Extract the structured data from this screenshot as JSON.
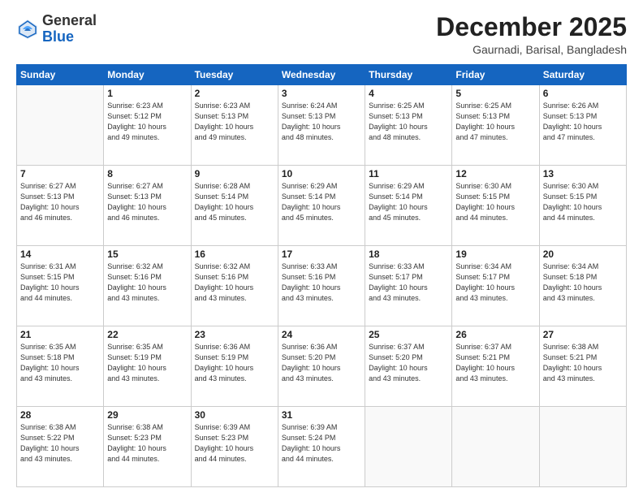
{
  "logo": {
    "general": "General",
    "blue": "Blue"
  },
  "header": {
    "month": "December 2025",
    "location": "Gaurnadi, Barisal, Bangladesh"
  },
  "weekdays": [
    "Sunday",
    "Monday",
    "Tuesday",
    "Wednesday",
    "Thursday",
    "Friday",
    "Saturday"
  ],
  "weeks": [
    [
      {
        "day": "",
        "info": ""
      },
      {
        "day": "1",
        "info": "Sunrise: 6:23 AM\nSunset: 5:12 PM\nDaylight: 10 hours\nand 49 minutes."
      },
      {
        "day": "2",
        "info": "Sunrise: 6:23 AM\nSunset: 5:13 PM\nDaylight: 10 hours\nand 49 minutes."
      },
      {
        "day": "3",
        "info": "Sunrise: 6:24 AM\nSunset: 5:13 PM\nDaylight: 10 hours\nand 48 minutes."
      },
      {
        "day": "4",
        "info": "Sunrise: 6:25 AM\nSunset: 5:13 PM\nDaylight: 10 hours\nand 48 minutes."
      },
      {
        "day": "5",
        "info": "Sunrise: 6:25 AM\nSunset: 5:13 PM\nDaylight: 10 hours\nand 47 minutes."
      },
      {
        "day": "6",
        "info": "Sunrise: 6:26 AM\nSunset: 5:13 PM\nDaylight: 10 hours\nand 47 minutes."
      }
    ],
    [
      {
        "day": "7",
        "info": "Sunrise: 6:27 AM\nSunset: 5:13 PM\nDaylight: 10 hours\nand 46 minutes."
      },
      {
        "day": "8",
        "info": "Sunrise: 6:27 AM\nSunset: 5:13 PM\nDaylight: 10 hours\nand 46 minutes."
      },
      {
        "day": "9",
        "info": "Sunrise: 6:28 AM\nSunset: 5:14 PM\nDaylight: 10 hours\nand 45 minutes."
      },
      {
        "day": "10",
        "info": "Sunrise: 6:29 AM\nSunset: 5:14 PM\nDaylight: 10 hours\nand 45 minutes."
      },
      {
        "day": "11",
        "info": "Sunrise: 6:29 AM\nSunset: 5:14 PM\nDaylight: 10 hours\nand 45 minutes."
      },
      {
        "day": "12",
        "info": "Sunrise: 6:30 AM\nSunset: 5:15 PM\nDaylight: 10 hours\nand 44 minutes."
      },
      {
        "day": "13",
        "info": "Sunrise: 6:30 AM\nSunset: 5:15 PM\nDaylight: 10 hours\nand 44 minutes."
      }
    ],
    [
      {
        "day": "14",
        "info": "Sunrise: 6:31 AM\nSunset: 5:15 PM\nDaylight: 10 hours\nand 44 minutes."
      },
      {
        "day": "15",
        "info": "Sunrise: 6:32 AM\nSunset: 5:16 PM\nDaylight: 10 hours\nand 43 minutes."
      },
      {
        "day": "16",
        "info": "Sunrise: 6:32 AM\nSunset: 5:16 PM\nDaylight: 10 hours\nand 43 minutes."
      },
      {
        "day": "17",
        "info": "Sunrise: 6:33 AM\nSunset: 5:16 PM\nDaylight: 10 hours\nand 43 minutes."
      },
      {
        "day": "18",
        "info": "Sunrise: 6:33 AM\nSunset: 5:17 PM\nDaylight: 10 hours\nand 43 minutes."
      },
      {
        "day": "19",
        "info": "Sunrise: 6:34 AM\nSunset: 5:17 PM\nDaylight: 10 hours\nand 43 minutes."
      },
      {
        "day": "20",
        "info": "Sunrise: 6:34 AM\nSunset: 5:18 PM\nDaylight: 10 hours\nand 43 minutes."
      }
    ],
    [
      {
        "day": "21",
        "info": "Sunrise: 6:35 AM\nSunset: 5:18 PM\nDaylight: 10 hours\nand 43 minutes."
      },
      {
        "day": "22",
        "info": "Sunrise: 6:35 AM\nSunset: 5:19 PM\nDaylight: 10 hours\nand 43 minutes."
      },
      {
        "day": "23",
        "info": "Sunrise: 6:36 AM\nSunset: 5:19 PM\nDaylight: 10 hours\nand 43 minutes."
      },
      {
        "day": "24",
        "info": "Sunrise: 6:36 AM\nSunset: 5:20 PM\nDaylight: 10 hours\nand 43 minutes."
      },
      {
        "day": "25",
        "info": "Sunrise: 6:37 AM\nSunset: 5:20 PM\nDaylight: 10 hours\nand 43 minutes."
      },
      {
        "day": "26",
        "info": "Sunrise: 6:37 AM\nSunset: 5:21 PM\nDaylight: 10 hours\nand 43 minutes."
      },
      {
        "day": "27",
        "info": "Sunrise: 6:38 AM\nSunset: 5:21 PM\nDaylight: 10 hours\nand 43 minutes."
      }
    ],
    [
      {
        "day": "28",
        "info": "Sunrise: 6:38 AM\nSunset: 5:22 PM\nDaylight: 10 hours\nand 43 minutes."
      },
      {
        "day": "29",
        "info": "Sunrise: 6:38 AM\nSunset: 5:23 PM\nDaylight: 10 hours\nand 44 minutes."
      },
      {
        "day": "30",
        "info": "Sunrise: 6:39 AM\nSunset: 5:23 PM\nDaylight: 10 hours\nand 44 minutes."
      },
      {
        "day": "31",
        "info": "Sunrise: 6:39 AM\nSunset: 5:24 PM\nDaylight: 10 hours\nand 44 minutes."
      },
      {
        "day": "",
        "info": ""
      },
      {
        "day": "",
        "info": ""
      },
      {
        "day": "",
        "info": ""
      }
    ]
  ]
}
